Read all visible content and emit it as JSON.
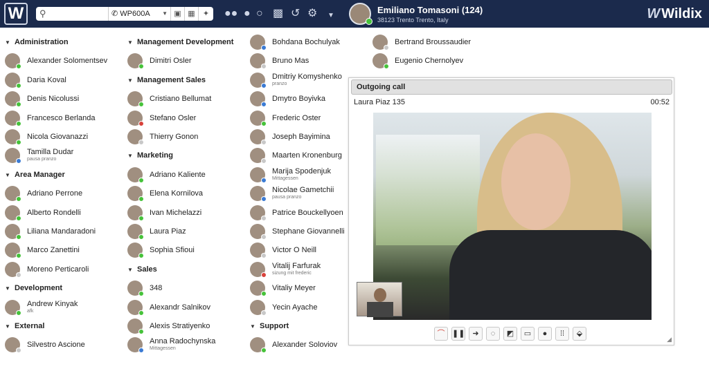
{
  "topbar": {
    "logo": "W",
    "search_placeholder": "",
    "device": "WP600A",
    "user": {
      "name": "Emiliano Tomasoni (124)",
      "location": "38123 Trento Trento, Italy"
    },
    "brand": "Wildix",
    "icons": [
      "search-icon",
      "phone-icon",
      "chevron-down-icon",
      "transfer-icon",
      "keypad-icon",
      "pin-icon",
      "users-icon",
      "location-icon",
      "chat-icon",
      "phonebook-icon",
      "history-icon",
      "settings-icon",
      "caret-down-icon"
    ]
  },
  "columns": [
    [
      {
        "group": "Administration"
      },
      {
        "name": "Alexander Solomentsev",
        "status": "green"
      },
      {
        "name": "Daria Koval",
        "status": "green"
      },
      {
        "name": "Denis Nicolussi",
        "status": "green"
      },
      {
        "name": "Francesco Berlanda",
        "status": "green"
      },
      {
        "name": "Nicola Giovanazzi",
        "status": "green"
      },
      {
        "name": "Tamilla Dudar",
        "sub": "pausa pranzo",
        "status": "blue"
      },
      {
        "group": "Area Manager"
      },
      {
        "name": "Adriano Perrone",
        "status": "green"
      },
      {
        "name": "Alberto Rondelli",
        "status": "green"
      },
      {
        "name": "Liliana Mandaradoni",
        "status": "green"
      },
      {
        "name": "Marco Zanettini",
        "status": "green"
      },
      {
        "name": "Moreno Perticaroli",
        "status": "grey"
      },
      {
        "group": "Development"
      },
      {
        "name": "Andrew Kinyak",
        "sub": "afk",
        "status": "green"
      },
      {
        "group": "External"
      },
      {
        "name": "Silvestro Ascione",
        "status": "grey"
      }
    ],
    [
      {
        "group": "Management Development"
      },
      {
        "name": "Dimitri Osler",
        "status": "green"
      },
      {
        "group": "Management Sales"
      },
      {
        "name": "Cristiano Bellumat",
        "status": "green"
      },
      {
        "name": "Stefano Osler",
        "status": "red"
      },
      {
        "name": "Thierry Gonon",
        "status": "grey"
      },
      {
        "group": "Marketing"
      },
      {
        "name": "Adriano Kaliente",
        "status": "green"
      },
      {
        "name": "Elena Kornilova",
        "status": "green"
      },
      {
        "name": "Ivan Michelazzi",
        "status": "green"
      },
      {
        "name": "Laura Piaz",
        "status": "green"
      },
      {
        "name": "Sophia Sfioui",
        "status": "green"
      },
      {
        "group": "Sales"
      },
      {
        "name": "348",
        "status": "green"
      },
      {
        "name": "Alexandr Salnikov",
        "status": "green"
      },
      {
        "name": "Alexis Stratiyenko",
        "status": "green"
      },
      {
        "name": "Anna Radochynska",
        "sub": "Mittagessen",
        "status": "blue"
      }
    ],
    [
      {
        "name": "Bohdana Bochulyak",
        "status": "blue"
      },
      {
        "name": "Bruno Mas",
        "status": "grey"
      },
      {
        "name": "Dmitriy Komyshenko",
        "sub": "pranzo",
        "status": "blue"
      },
      {
        "name": "Dmytro Boyivka",
        "status": "blue"
      },
      {
        "name": "Frederic Oster",
        "status": "green"
      },
      {
        "name": "Joseph Bayimina",
        "status": "grey"
      },
      {
        "name": "Maarten Kronenburg",
        "status": "grey"
      },
      {
        "name": "Marija Spodenjuk",
        "sub": "Mittagessen",
        "status": "blue"
      },
      {
        "name": "Nicolae Gametchii",
        "sub": "pausa pranzo",
        "status": "blue"
      },
      {
        "name": "Patrice Bouckellyoen",
        "status": "grey"
      },
      {
        "name": "Stephane Giovannelli",
        "status": "grey"
      },
      {
        "name": "Victor O Neill",
        "status": "grey"
      },
      {
        "name": "Vitalij Farfurak",
        "sub": "sizung mit frederic",
        "status": "red"
      },
      {
        "name": "Vitaliy Meyer",
        "status": "green"
      },
      {
        "name": "Yecin Ayache",
        "status": "grey"
      },
      {
        "group": "Support"
      },
      {
        "name": "Alexander Soloviov",
        "status": "green"
      }
    ],
    [
      {
        "name": "Bertrand Broussaudier",
        "status": "grey"
      },
      {
        "name": "Eugenio Chernolyev",
        "status": "green"
      }
    ]
  ],
  "call": {
    "title": "Outgoing call",
    "caller": "Laura Piaz 135",
    "duration": "00:52",
    "controls": [
      {
        "name": "hangup",
        "glyph": "⌒"
      },
      {
        "name": "hold",
        "glyph": "❚❚"
      },
      {
        "name": "transfer",
        "glyph": "➜"
      },
      {
        "name": "chat",
        "glyph": "◌"
      },
      {
        "name": "video-off",
        "glyph": "◩"
      },
      {
        "name": "screen-share",
        "glyph": "▭"
      },
      {
        "name": "record",
        "glyph": "●"
      },
      {
        "name": "keypad",
        "glyph": "⁞⁞"
      },
      {
        "name": "tag",
        "glyph": "⬙"
      }
    ]
  },
  "colors": {
    "topbar": "#1b2a4c",
    "online": "#46c23a",
    "busy": "#d8413a",
    "away": "#3b7bd4",
    "offline": "#c8c8c8"
  }
}
